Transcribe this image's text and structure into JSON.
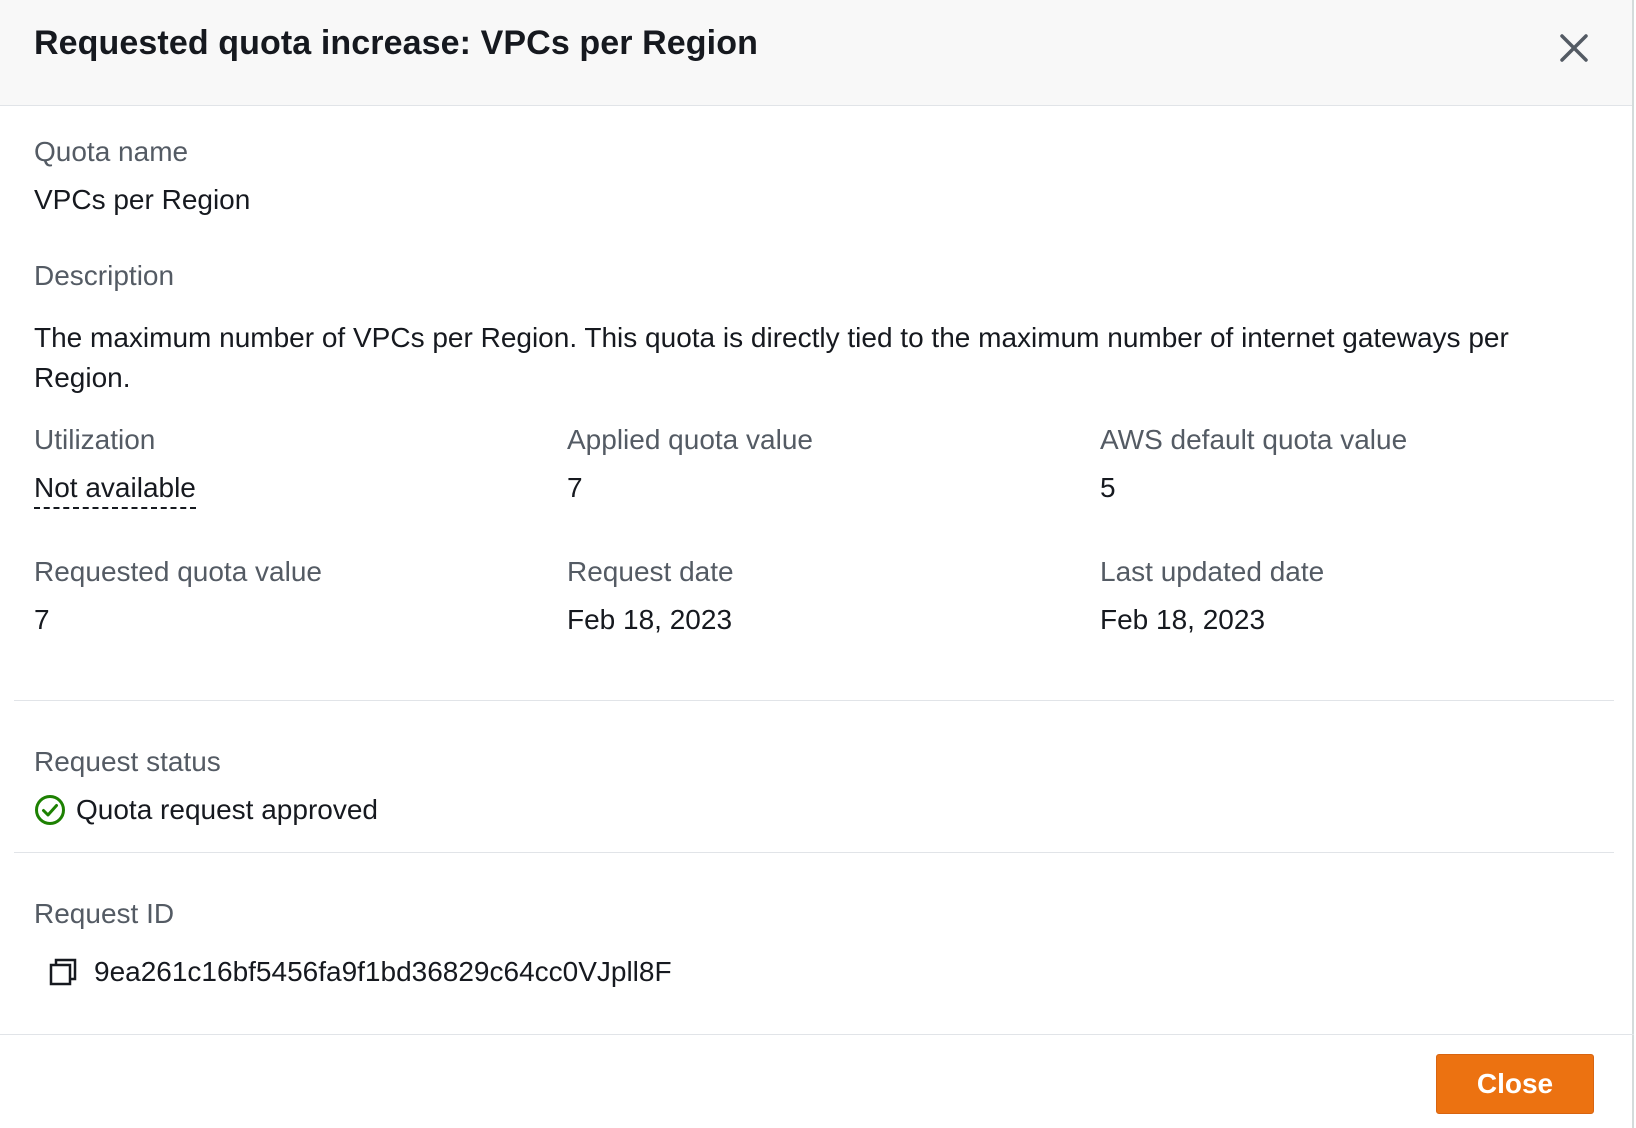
{
  "modal": {
    "title": "Requested quota increase: VPCs per Region",
    "close_icon": "close-icon",
    "close_button_label": "Close"
  },
  "fields": {
    "quota_name": {
      "label": "Quota name",
      "value": "VPCs per Region"
    },
    "description": {
      "label": "Description",
      "value": "The maximum number of VPCs per Region. This quota is directly tied to the maximum number of internet gateways per Region."
    },
    "utilization": {
      "label": "Utilization",
      "value": "Not available"
    },
    "applied_quota_value": {
      "label": "Applied quota value",
      "value": "7"
    },
    "aws_default_quota_value": {
      "label": "AWS default quota value",
      "value": "5"
    },
    "requested_quota_value": {
      "label": "Requested quota value",
      "value": "7"
    },
    "request_date": {
      "label": "Request date",
      "value": "Feb 18, 2023"
    },
    "last_updated_date": {
      "label": "Last updated date",
      "value": "Feb 18, 2023"
    },
    "request_status": {
      "label": "Request status",
      "value": "Quota request approved",
      "icon": "check-circle-icon",
      "color": "#1d8102"
    },
    "request_id": {
      "label": "Request ID",
      "value": "9ea261c16bf5456fa9f1bd36829c64cc0VJpll8F",
      "icon": "copy-icon"
    }
  },
  "colors": {
    "primary_button": "#ec7211",
    "success": "#1d8102",
    "label_text": "#545b64",
    "header_bg": "#f8f8f8"
  }
}
